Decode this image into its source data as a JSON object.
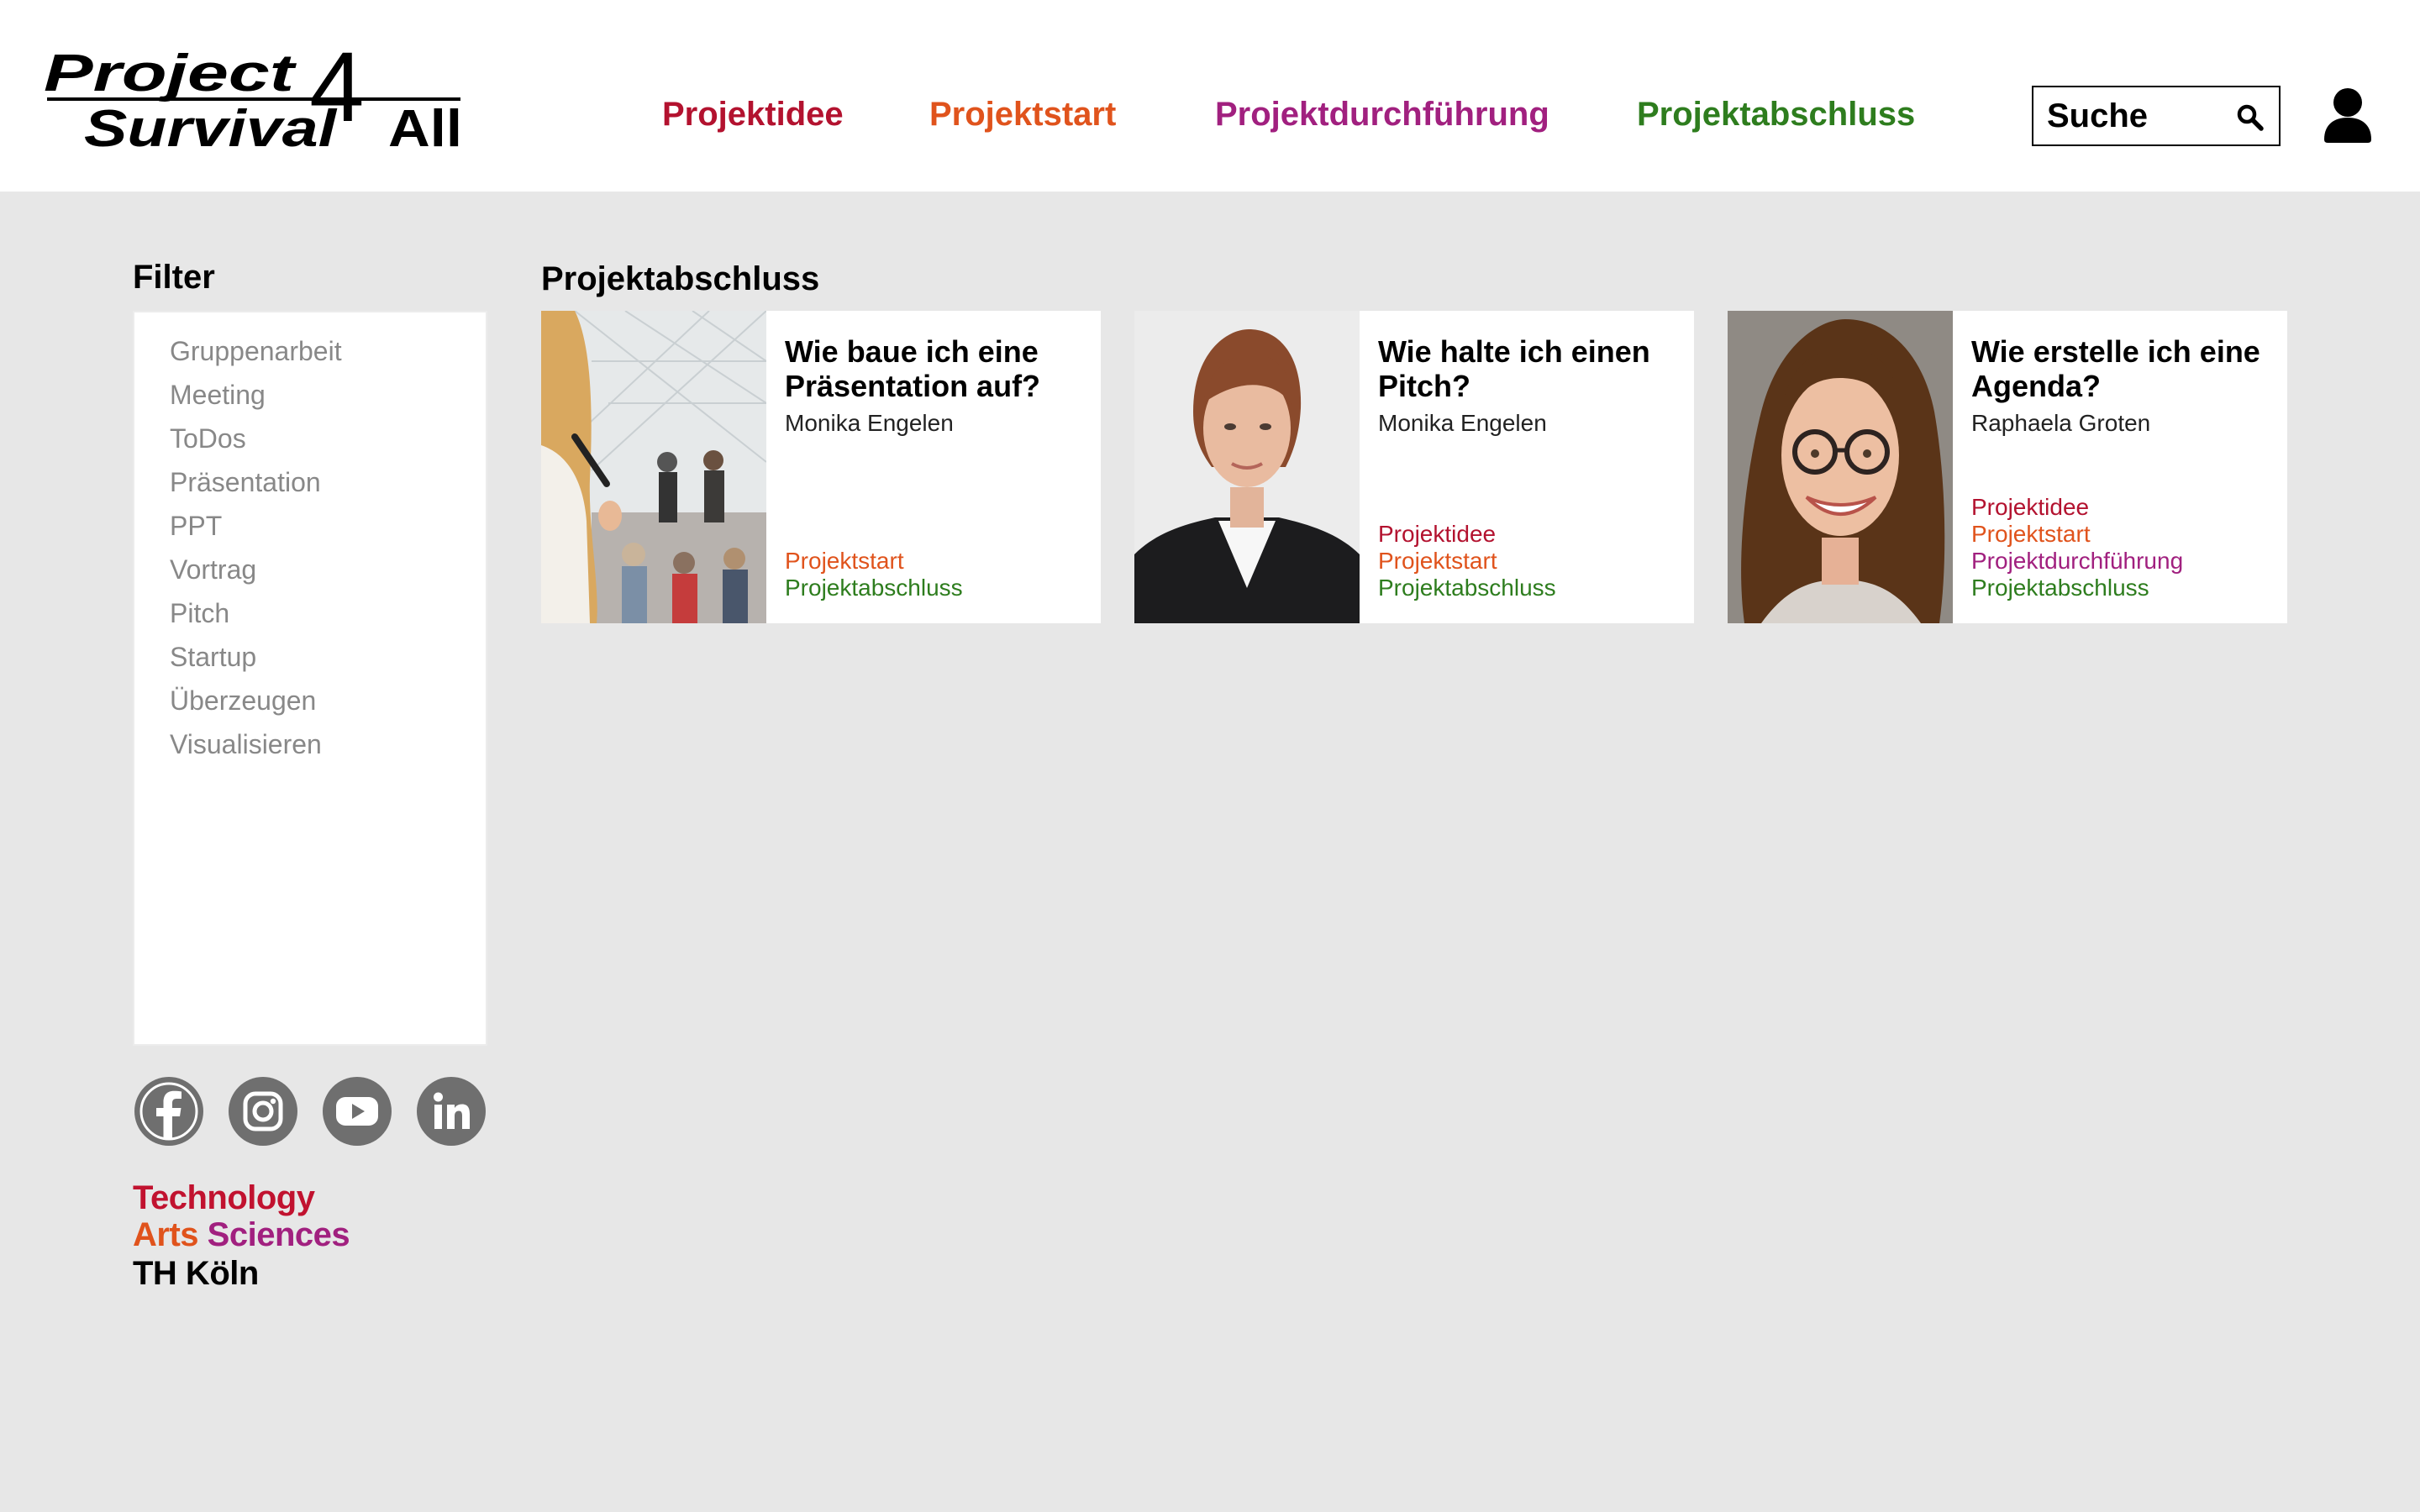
{
  "brand": {
    "logo_line1": "Project",
    "logo_line2": "Survival",
    "logo_mark": "4",
    "logo_line3": "All"
  },
  "colors": {
    "projektidee": "#b3122f",
    "projektstart": "#e0531c",
    "projektdurchfuehrung": "#a1207f",
    "projektabschluss": "#2e7d1e"
  },
  "nav": {
    "items": [
      {
        "label": "Projektidee"
      },
      {
        "label": "Projektstart"
      },
      {
        "label": "Projektdurchführung"
      },
      {
        "label": "Projektabschluss"
      }
    ]
  },
  "search": {
    "placeholder": "Suche",
    "icon": "search-icon"
  },
  "account": {
    "icon": "user-icon"
  },
  "filter": {
    "title": "Filter",
    "items": [
      {
        "label": "Gruppenarbeit"
      },
      {
        "label": "Meeting"
      },
      {
        "label": "ToDos"
      },
      {
        "label": "Präsentation"
      },
      {
        "label": "PPT"
      },
      {
        "label": "Vortrag"
      },
      {
        "label": "Pitch"
      },
      {
        "label": "Startup"
      },
      {
        "label": "Überzeugen"
      },
      {
        "label": "Visualisieren"
      }
    ]
  },
  "social": {
    "icons": [
      "facebook-icon",
      "instagram-icon",
      "youtube-icon",
      "linkedin-icon"
    ]
  },
  "th_logo": {
    "line1": "Technology",
    "line2a": "Arts",
    "line2b": "Sciences",
    "line3": "TH Köln"
  },
  "main": {
    "section_title": "Projektabschluss",
    "cards": [
      {
        "title": "Wie baue ich eine Präsentation auf?",
        "author": "Monika Engelen",
        "tags": [
          "Projektstart",
          "Projektabschluss"
        ]
      },
      {
        "title": "Wie halte ich einen Pitch?",
        "author": "Monika Engelen",
        "tags": [
          "Projektidee",
          "Projektstart",
          "Projektabschluss"
        ]
      },
      {
        "title": "Wie erstelle ich eine Agenda?",
        "author": "Raphaela Groten",
        "tags": [
          "Projektidee",
          "Projektstart",
          "Projektdurchführung",
          "Projektabschluss"
        ]
      }
    ]
  }
}
